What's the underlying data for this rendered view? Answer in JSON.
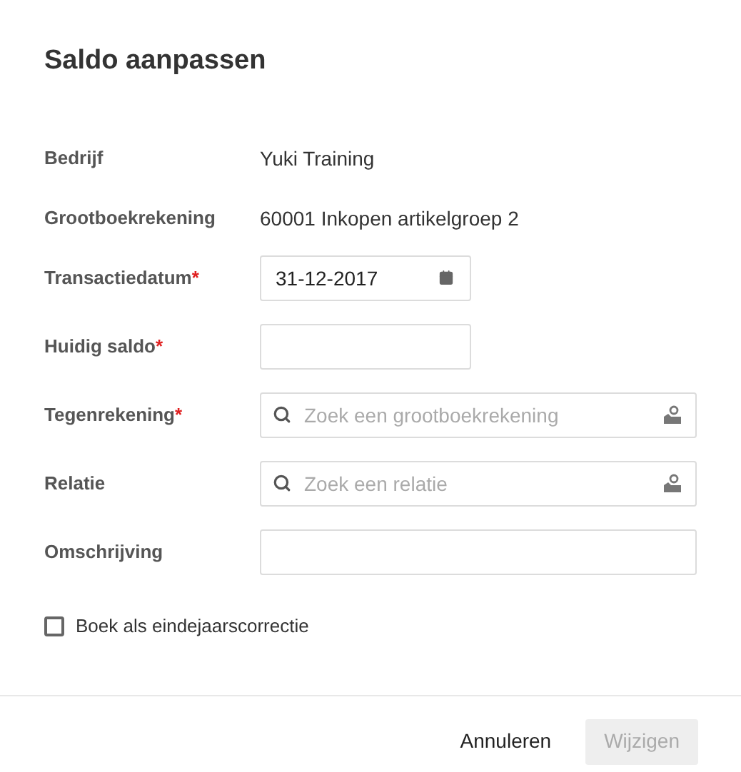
{
  "title": "Saldo aanpassen",
  "fields": [
    {
      "kind": "text",
      "label": "Bedrijf",
      "value": "Yuki Training"
    },
    {
      "kind": "text",
      "label": "Grootboekrekening",
      "value": "60001 Inkopen artikelgroep 2"
    },
    {
      "kind": "date",
      "label": "Transactiedatum",
      "required_mark": "*",
      "value": "31-12-2017"
    },
    {
      "kind": "input",
      "label": "Huidig saldo",
      "required_mark": "*"
    },
    {
      "kind": "search",
      "label": "Tegenrekening",
      "required_mark": "*",
      "placeholder": "Zoek een grootboekrekening"
    },
    {
      "kind": "search",
      "label": "Relatie",
      "placeholder": "Zoek een relatie"
    },
    {
      "kind": "wide_input",
      "label": "Omschrijving"
    }
  ],
  "checkbox": {
    "label": "Boek als eindejaarscorrectie",
    "checked": false
  },
  "buttons": [
    {
      "kind": "link",
      "label": "Annuleren",
      "disabled": false
    },
    {
      "kind": "primary",
      "label": "Wijzigen",
      "disabled": true
    }
  ]
}
